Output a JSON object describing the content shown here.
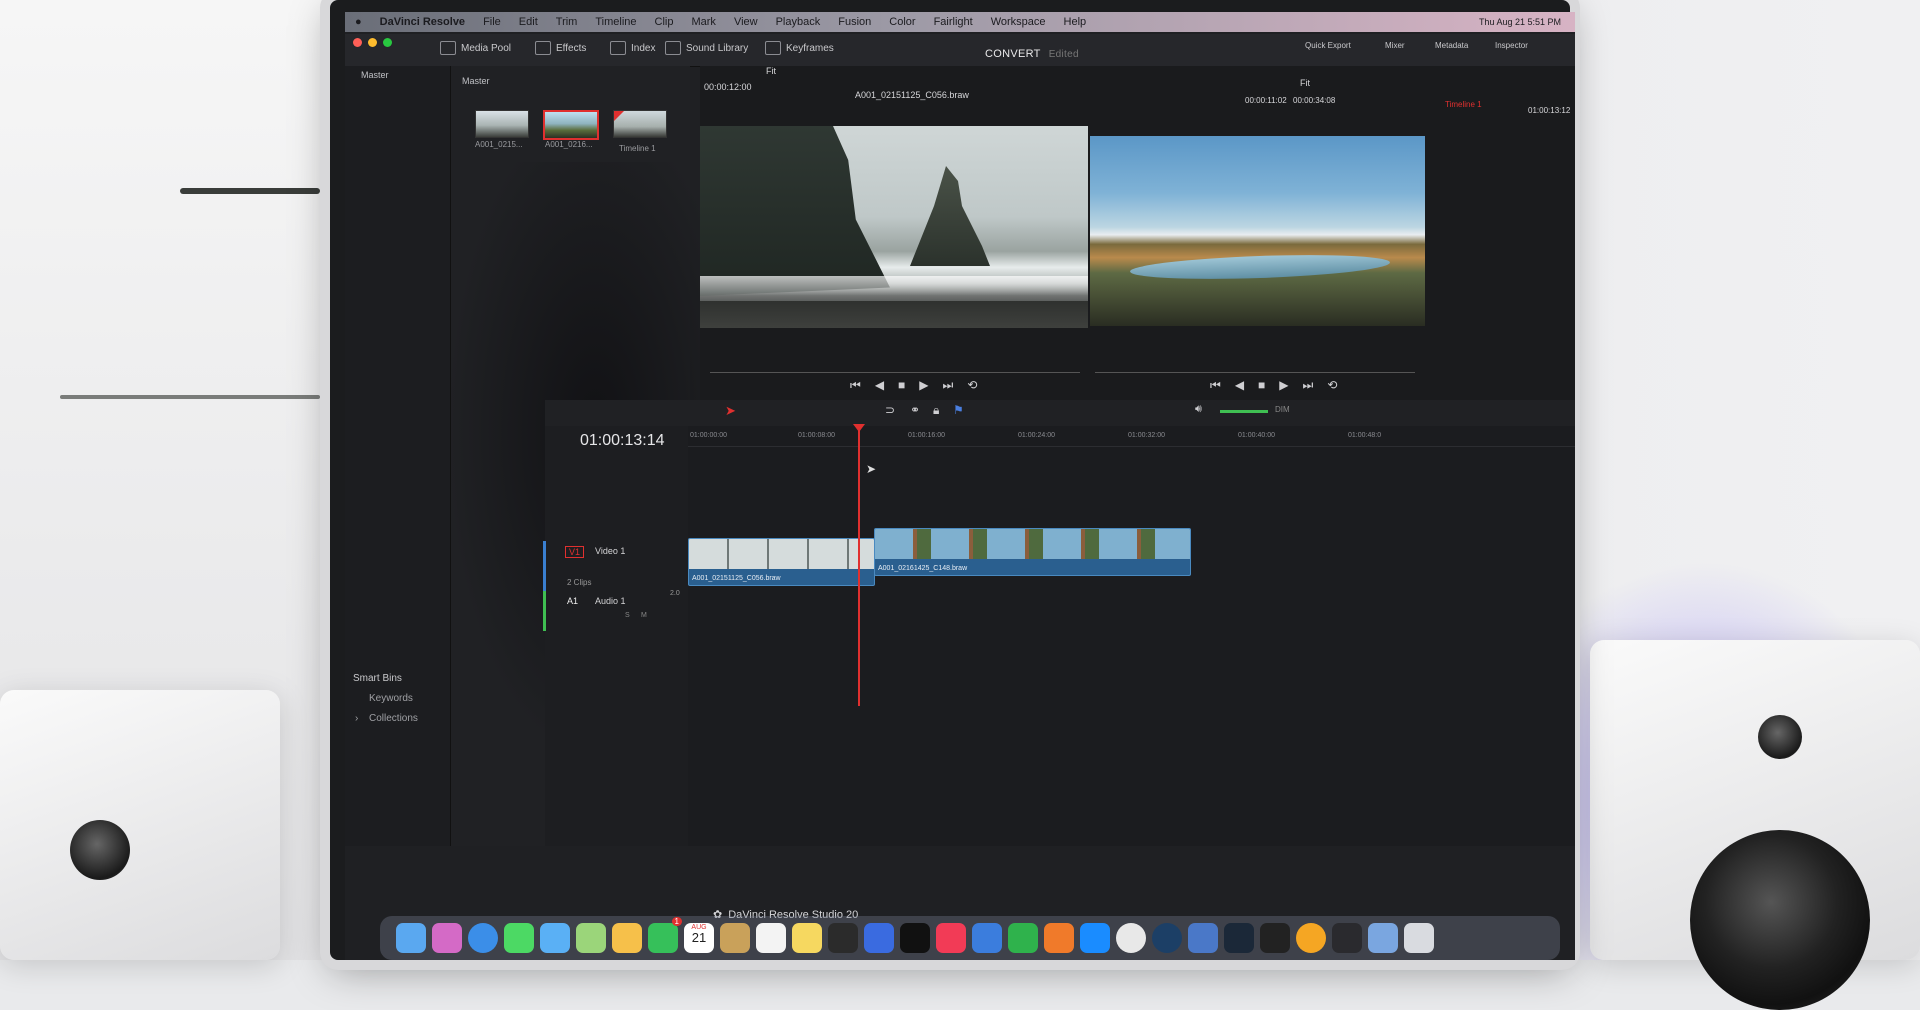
{
  "menubar": {
    "app_name": "DaVinci Resolve",
    "items": [
      "File",
      "Edit",
      "Trim",
      "Timeline",
      "Clip",
      "Mark",
      "View",
      "Playback",
      "Fusion",
      "Color",
      "Fairlight",
      "Workspace",
      "Help"
    ],
    "clock": "Thu Aug 21  5:51 PM"
  },
  "toolbar": {
    "media_pool": "Media Pool",
    "effects": "Effects",
    "index": "Index",
    "sound_library": "Sound Library",
    "keyframes": "Keyframes",
    "quick_export": "Quick Export",
    "mixer": "Mixer",
    "metadata": "Metadata",
    "inspector": "Inspector",
    "page_title": "CONVERT",
    "page_status": "Edited"
  },
  "media_pool": {
    "bin_label": "Master",
    "list_label": "Master",
    "clips": [
      {
        "name": "A001_0215..."
      },
      {
        "name": "A001_0216..."
      },
      {
        "name": "Timeline 1"
      }
    ],
    "smart_bins": "Smart Bins",
    "keywords": "Keywords",
    "collections": "Collections"
  },
  "viewer": {
    "source_tc": "00:00:12:00",
    "source_fit": "Fit",
    "clip_name": "A001_02151125_C056.braw",
    "tc_in": "00:00:11:02",
    "tc_dur": "00:00:34:08",
    "program_fit": "Fit",
    "timeline_name": "Timeline 1",
    "program_tc": "01:00:13:12"
  },
  "timeline": {
    "timecode": "01:00:13:14",
    "ruler": [
      "01:00:00:00",
      "01:00:08:00",
      "01:00:16:00",
      "01:00:24:00",
      "01:00:32:00",
      "01:00:40:00",
      "01:00:48:0"
    ],
    "video_track": {
      "id": "V1",
      "name": "Video 1",
      "count": "2 Clips"
    },
    "audio_track": {
      "id": "A1",
      "name": "Audio 1",
      "channels": "2.0",
      "solo": "S",
      "mute": "M"
    },
    "clips": [
      {
        "name": "A001_02151125_C056.braw"
      },
      {
        "name": "A001_02161425_C148.braw"
      }
    ],
    "volume_label": "DIM"
  },
  "footer": {
    "product": "DaVinci Resolve Studio 20"
  },
  "dock": {
    "calendar_month": "AUG",
    "calendar_day": "21",
    "badge": "1"
  },
  "colors": {
    "accent_red": "#e0302f",
    "clip_blue": "#2a5f8f",
    "ui_dark": "#1f2023"
  }
}
